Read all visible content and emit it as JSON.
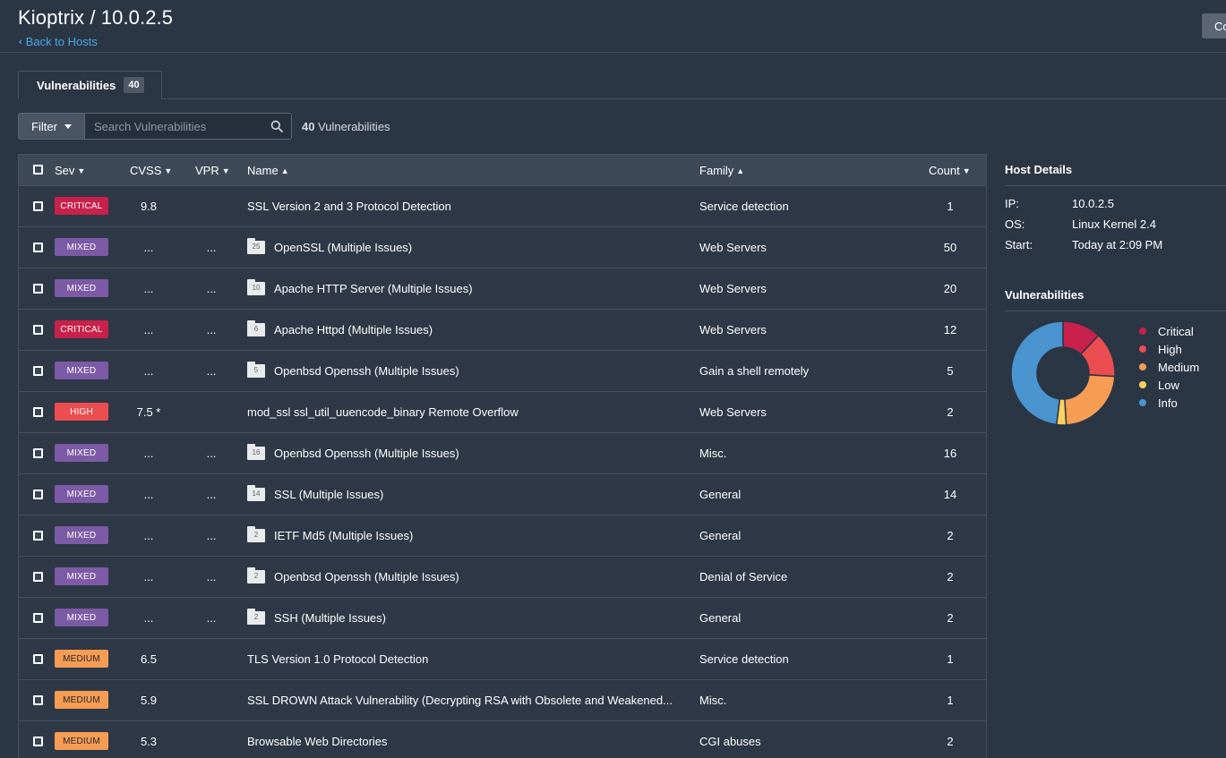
{
  "page": {
    "title": "Kioptrix / 10.0.2.5",
    "back_label": "Back to Hosts",
    "top_right_label": "Co"
  },
  "tab": {
    "label": "Vulnerabilities",
    "count": "40"
  },
  "filter": {
    "button_label": "Filter",
    "search_placeholder": "Search Vulnerabilities",
    "total_count": "40",
    "total_label": "Vulnerabilities"
  },
  "table": {
    "headers": {
      "sev": "Sev",
      "cvss": "CVSS",
      "vpr": "VPR",
      "name": "Name",
      "family": "Family",
      "count": "Count"
    },
    "rows": [
      {
        "sev": "CRITICAL",
        "cvss": "9.8",
        "vpr": "",
        "folder": "",
        "name": "SSL Version 2 and 3 Protocol Detection",
        "family": "Service detection",
        "count": "1"
      },
      {
        "sev": "MIXED",
        "cvss": "...",
        "vpr": "...",
        "folder": "25",
        "name": "OpenSSL (Multiple Issues)",
        "family": "Web Servers",
        "count": "50"
      },
      {
        "sev": "MIXED",
        "cvss": "...",
        "vpr": "...",
        "folder": "10",
        "name": "Apache HTTP Server (Multiple Issues)",
        "family": "Web Servers",
        "count": "20"
      },
      {
        "sev": "CRITICAL",
        "cvss": "...",
        "vpr": "...",
        "folder": "6",
        "name": "Apache Httpd (Multiple Issues)",
        "family": "Web Servers",
        "count": "12"
      },
      {
        "sev": "MIXED",
        "cvss": "...",
        "vpr": "...",
        "folder": "5",
        "name": "Openbsd Openssh (Multiple Issues)",
        "family": "Gain a shell remotely",
        "count": "5"
      },
      {
        "sev": "HIGH",
        "cvss": "7.5 *",
        "vpr": "",
        "folder": "",
        "name": "mod_ssl ssl_util_uuencode_binary Remote Overflow",
        "family": "Web Servers",
        "count": "2"
      },
      {
        "sev": "MIXED",
        "cvss": "...",
        "vpr": "...",
        "folder": "16",
        "name": "Openbsd Openssh (Multiple Issues)",
        "family": "Misc.",
        "count": "16"
      },
      {
        "sev": "MIXED",
        "cvss": "...",
        "vpr": "...",
        "folder": "14",
        "name": "SSL (Multiple Issues)",
        "family": "General",
        "count": "14"
      },
      {
        "sev": "MIXED",
        "cvss": "...",
        "vpr": "...",
        "folder": "2",
        "name": "IETF Md5 (Multiple Issues)",
        "family": "General",
        "count": "2"
      },
      {
        "sev": "MIXED",
        "cvss": "...",
        "vpr": "...",
        "folder": "2",
        "name": "Openbsd Openssh (Multiple Issues)",
        "family": "Denial of Service",
        "count": "2"
      },
      {
        "sev": "MIXED",
        "cvss": "...",
        "vpr": "...",
        "folder": "2",
        "name": "SSH (Multiple Issues)",
        "family": "General",
        "count": "2"
      },
      {
        "sev": "MEDIUM",
        "cvss": "6.5",
        "vpr": "",
        "folder": "",
        "name": "TLS Version 1.0 Protocol Detection",
        "family": "Service detection",
        "count": "1"
      },
      {
        "sev": "MEDIUM",
        "cvss": "5.9",
        "vpr": "",
        "folder": "",
        "name": "SSL DROWN Attack Vulnerability (Decrypting RSA with Obsolete and Weakened...",
        "family": "Misc.",
        "count": "1"
      },
      {
        "sev": "MEDIUM",
        "cvss": "5.3",
        "vpr": "",
        "folder": "",
        "name": "Browsable Web Directories",
        "family": "CGI abuses",
        "count": "2"
      }
    ]
  },
  "host_details": {
    "heading": "Host Details",
    "ip_label": "IP:",
    "ip": "10.0.2.5",
    "os_label": "OS:",
    "os": "Linux Kernel 2.4",
    "start_label": "Start:",
    "start": "Today at 2:09 PM"
  },
  "vuln_chart": {
    "heading": "Vulnerabilities",
    "legend": [
      {
        "label": "Critical",
        "color": "#c8214c"
      },
      {
        "label": "High",
        "color": "#eb4d51"
      },
      {
        "label": "Medium",
        "color": "#f69c53"
      },
      {
        "label": "Low",
        "color": "#fdd25f"
      },
      {
        "label": "Info",
        "color": "#4a94cf"
      }
    ],
    "fractions": [
      0.12,
      0.14,
      0.23,
      0.03,
      0.48
    ]
  }
}
